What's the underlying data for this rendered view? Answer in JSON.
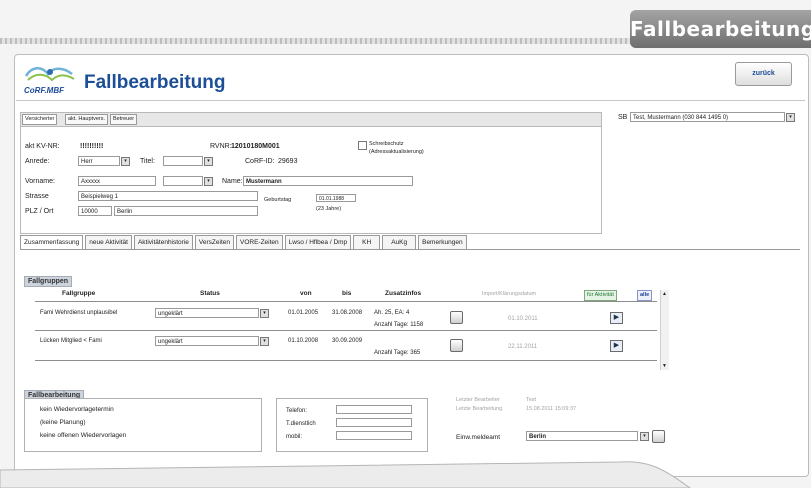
{
  "corner_title": "Fallbearbeitung",
  "header": {
    "logo_text": "CoRF.MBF",
    "title": "Fallbearbeitung",
    "back_label": "zurück"
  },
  "top_tabs": [
    "Versicherter",
    "akt. Hauptvers.",
    "Betreuer"
  ],
  "sb": {
    "label": "SB",
    "value": "Test, Mustermann (030 844 1495 0)"
  },
  "person": {
    "kvnr_label": "akt KV-NR:",
    "kvnr_value": "!!!!!!!!!!",
    "rvnr_label": "RVNR:",
    "rvnr_value": "12010180M001",
    "schreibschutz": "Schreibschutz",
    "adressaktualisierung": "(Adressaktualisierung)",
    "anrede_label": "Anrede:",
    "anrede_value": "Herr",
    "titel_label": "Titel:",
    "titel_value": "",
    "corf_label": "CoRF-ID:",
    "corf_value": "29693",
    "vorname_label": "Vorname:",
    "vorname_value": "Axxxxx",
    "name_label": "Name:",
    "name_value": "Mustermann",
    "strasse_label": "Strasse",
    "strasse_value": "Beispielweg 1",
    "geburtstag_label": "Geburtstag",
    "geburtstag_value": "01.01.1988",
    "alter": "(23 Jahre)",
    "plz_label": "PLZ / Ort",
    "plz_value": "10000",
    "ort_value": "Berlin"
  },
  "tabs": [
    "Zusammenfassung",
    "neue Aktivität",
    "Aktivitätenhistorie",
    "VersZeiten",
    "VORE-Zeiten",
    "Lwso / Hflbea / Dmp",
    "KH",
    "AuKg",
    "Bemerkungen"
  ],
  "fallgruppen": {
    "header": "Fallgruppen",
    "columns": [
      "Fallgruppe",
      "Status",
      "von",
      "bis",
      "Zusatzinfos",
      "Import/Klärungsdatum"
    ],
    "btn_aktivitaet": "für Aktivität",
    "btn_alle": "alle",
    "rows": [
      {
        "fallgruppe": "Fami Wehrdienst unplausibel",
        "status": "ungeklärt",
        "von": "01.01.2005",
        "bis": "31.08.2008",
        "info1": "Ah. 25, EA: 4",
        "info2": "Anzahl Tage: 1158",
        "datum": "01.10.2011"
      },
      {
        "fallgruppe": "Lücken Mitglied < Fami",
        "status": "ungeklärt",
        "von": "01.10.2008",
        "bis": "30.09.2009",
        "info1": "",
        "info2": "Anzahl Tage: 365",
        "datum": "22.11.2011"
      }
    ]
  },
  "fallbearbeitung": {
    "header": "Fallbearbeitung",
    "lines": [
      "kein Wiedervorlagetermin",
      "(keine Planung)",
      "keine offenen Wiedervorlagen"
    ],
    "telefon_label": "Telefon:",
    "tdienst_label": "T.dienstlich",
    "mobil_label": "mobil:",
    "letzter_bearbeiter_label": "Letzter Bearbeiter",
    "letzter_bearbeiter_value": "Test",
    "letzte_bearbeitung_label": "Letzte Bearbeitung",
    "letzte_bearbeitung_value": "15.08.2011 15:09:37",
    "einwohner_label": "Einw.meldeamt",
    "einwohner_value": "Berlin"
  }
}
